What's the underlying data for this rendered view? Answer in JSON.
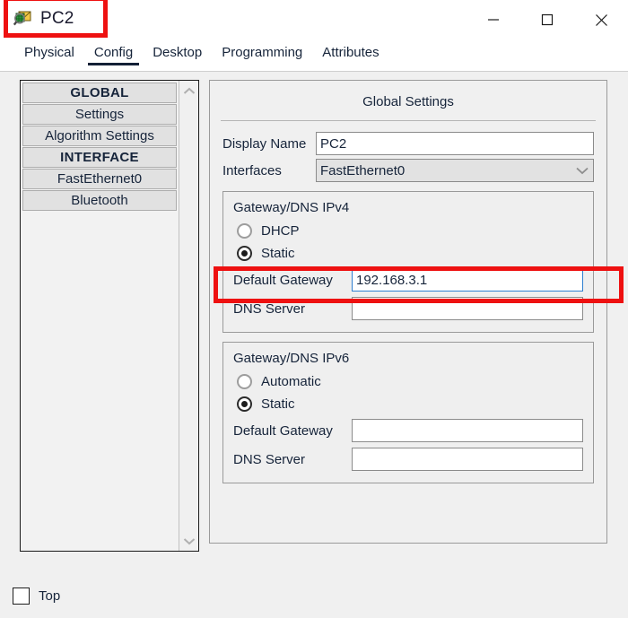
{
  "window": {
    "title": "PC2",
    "icon": "packet-tracer-inspect-icon",
    "controls": {
      "minimize": "—",
      "maximize": "□",
      "close": "✕"
    }
  },
  "tabs": [
    {
      "label": "Physical",
      "active": false
    },
    {
      "label": "Config",
      "active": true
    },
    {
      "label": "Desktop",
      "active": false
    },
    {
      "label": "Programming",
      "active": false
    },
    {
      "label": "Attributes",
      "active": false
    }
  ],
  "sidebar": {
    "items": [
      {
        "label": "GLOBAL",
        "header": true
      },
      {
        "label": "Settings",
        "header": false
      },
      {
        "label": "Algorithm Settings",
        "header": false
      },
      {
        "label": "INTERFACE",
        "header": true
      },
      {
        "label": "FastEthernet0",
        "header": false
      },
      {
        "label": "Bluetooth",
        "header": false
      }
    ],
    "scrollbar": {
      "up": "⌃",
      "down": "⌄"
    }
  },
  "main": {
    "panel_title": "Global Settings",
    "display_name": {
      "label": "Display Name",
      "value": "PC2",
      "placeholder": ""
    },
    "interfaces": {
      "label": "Interfaces",
      "selected": "FastEthernet0",
      "chevron": "⌄"
    },
    "ipv4": {
      "group_title": "Gateway/DNS IPv4",
      "radios": [
        {
          "label": "DHCP",
          "checked": false
        },
        {
          "label": "Static",
          "checked": true
        }
      ],
      "default_gateway": {
        "label": "Default Gateway",
        "value": "192.168.3.1",
        "focused": true
      },
      "dns_server": {
        "label": "DNS Server",
        "value": "",
        "focused": false
      }
    },
    "ipv6": {
      "group_title": "Gateway/DNS IPv6",
      "radios": [
        {
          "label": "Automatic",
          "checked": false
        },
        {
          "label": "Static",
          "checked": true
        }
      ],
      "default_gateway": {
        "label": "Default Gateway",
        "value": "",
        "focused": false
      },
      "dns_server": {
        "label": "DNS Server",
        "value": "",
        "focused": false
      }
    }
  },
  "bottom": {
    "top_checkbox": {
      "label": "Top",
      "checked": false
    }
  },
  "annotations": {
    "highlight_color": "#ee1111",
    "boxes": [
      {
        "name": "title-highlight",
        "target": "PC2"
      },
      {
        "name": "default-gateway-highlight",
        "target": "Default Gateway 192.168.3.1"
      }
    ]
  }
}
